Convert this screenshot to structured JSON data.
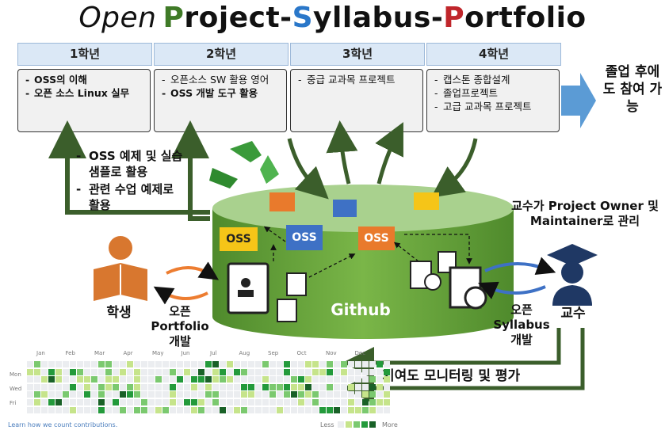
{
  "title": {
    "open": "Open",
    "p1": "P",
    "p2": "roject-",
    "s1": "S",
    "s2": "yllabus-",
    "r1": "P",
    "r2": "ortfolio"
  },
  "grades": [
    {
      "header": "1학년",
      "items": [
        "OSS의 이해",
        "오픈 소스 Linux 실무"
      ]
    },
    {
      "header": "2학년",
      "items": [
        "오픈소스 SW 활용 영어",
        "OSS 개발 도구 활용"
      ]
    },
    {
      "header": "3학년",
      "items": [
        "중급 교과목 프로젝트"
      ]
    },
    {
      "header": "4학년",
      "items": [
        "캡스톤 종합설계",
        "졸업프로젝트",
        "고급 교과목 프로젝트"
      ]
    }
  ],
  "graduation": "졸업 후에도 참여 가능",
  "left_notes": [
    "OSS 예제 및 실습 샘플로 활용",
    "관련 수업 예제로 활용"
  ],
  "oss_labels": [
    "OSS",
    "OSS",
    "OSS"
  ],
  "github_label": "Github",
  "student": {
    "label": "학생",
    "dev": "오픈 Portfolio 개발"
  },
  "professor": {
    "label": "교수",
    "dev": "오픈 Syllabus 개발",
    "role": "교수가 Project Owner 및 Maintainer로 관리"
  },
  "monitoring": "기여도 모니터링 및 평가",
  "contrib": {
    "months": [
      "Jan",
      "Feb",
      "Mar",
      "Apr",
      "May",
      "Jun",
      "Jul",
      "Aug",
      "Sep",
      "Oct",
      "Nov",
      "Dec"
    ],
    "days": [
      "Mon",
      "Wed",
      "Fri"
    ],
    "link": "Learn how we count contributions.",
    "less": "Less",
    "more": "More",
    "colors": [
      "#ebedf0",
      "#c6e48b",
      "#7bc96f",
      "#239a3b",
      "#196127"
    ]
  }
}
